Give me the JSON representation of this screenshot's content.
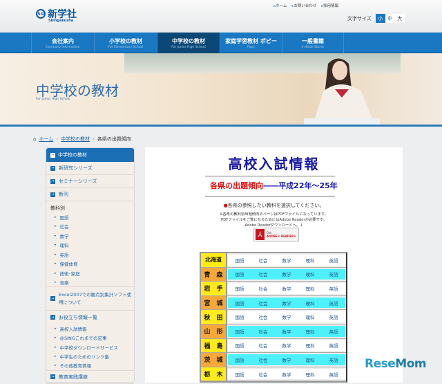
{
  "header": {
    "logo_text": "新学社",
    "logo_sub": "Shingakusha",
    "logo_mark": "SG",
    "top_links": [
      "ホーム",
      "お問い合わせ",
      "採用情報"
    ],
    "font_size_label": "文字サイズ",
    "font_sizes": [
      "小",
      "中",
      "大"
    ]
  },
  "nav": [
    {
      "label": "会社案内",
      "sub": "Company Information"
    },
    {
      "label": "小学校の教材",
      "sub": "For Elementary School"
    },
    {
      "label": "中学校の教材",
      "sub": "For Junior High School"
    },
    {
      "label": "家庭学習教材 ポピー",
      "sub": "Popy"
    },
    {
      "label": "一般書籍",
      "sub": "In Book Stores"
    }
  ],
  "banner": {
    "title": "中学校の教材",
    "sub": "For Junior High School"
  },
  "breadcrumb": [
    "ホーム",
    "中学校の教材",
    "各県の出題傾向"
  ],
  "sidebar": {
    "header": "中学校の教材",
    "items_top": [
      "新研究シリーズ",
      "セミナーシリーズ",
      "新刊"
    ],
    "category": "教科別",
    "subjects": [
      "国語",
      "社会",
      "数学",
      "理科",
      "英語",
      "保健体育",
      "技術･家庭",
      "音楽"
    ],
    "excel": "Excel2007での観点別集計ソフト使用について",
    "info": "お役立ち情報一覧",
    "info_items": [
      "高校入試情報",
      "@SINGこれまでの記事",
      "中学校ダウンロードサービス",
      "中学生のためのリンク集",
      "その他教育情報"
    ],
    "last": "教育実践講座"
  },
  "main": {
    "title": "高校入試情報",
    "subtitle_red": "各県の出題傾向",
    "subtitle_blue": "――平成22年～25年",
    "instruction": "各県の参照したい教科を選択してください。",
    "note1": "※各県の教科別出題傾向のページはPDFファイルになっています。",
    "note2": "PDFファイルをご覧になるためにはAdobe Readerが必要です。",
    "note3": "Adobe Readerダウンロードへ。↓",
    "adobe_get": "Get",
    "adobe_reader": "ADOBE® READER®"
  },
  "table": {
    "subjects": [
      "国語",
      "社会",
      "数学",
      "理科",
      "英語"
    ],
    "prefectures": [
      "北海道",
      "青　森",
      "岩　手",
      "宮　城",
      "秋　田",
      "山　形",
      "福　島",
      "茨　城",
      "栃　木"
    ]
  },
  "watermark": {
    "a": "Rese",
    "b": "Mom"
  }
}
